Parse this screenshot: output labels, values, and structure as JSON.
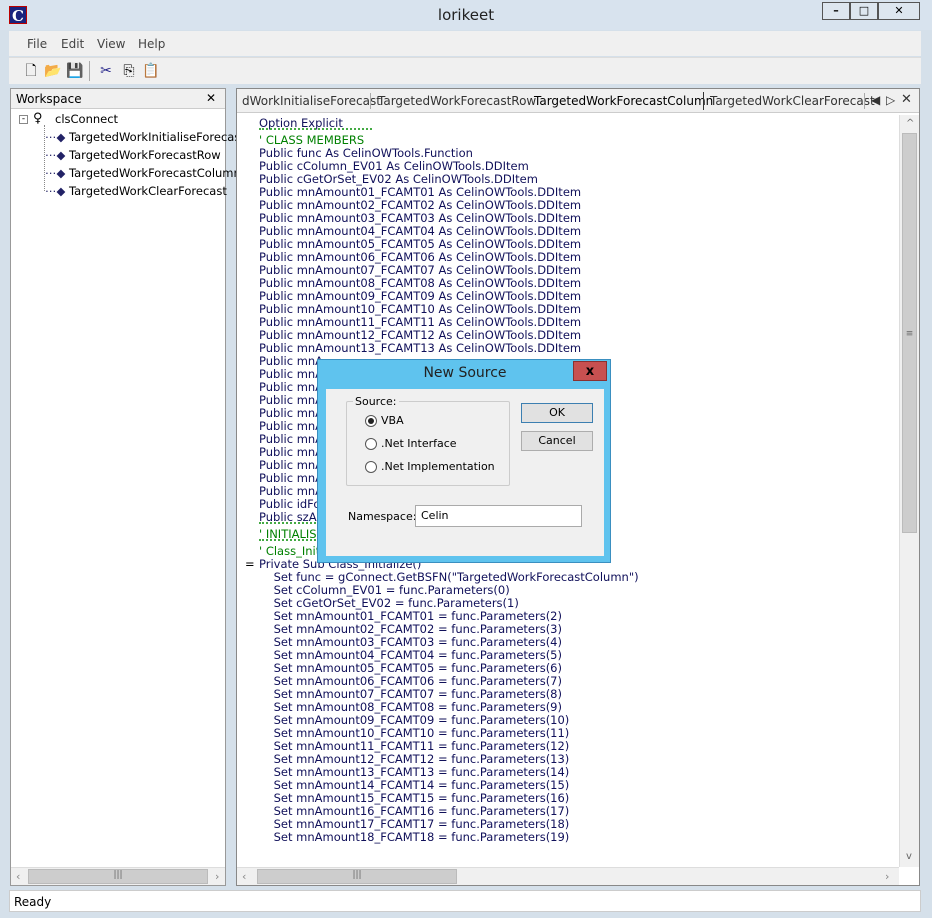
{
  "window": {
    "title": "lorikeet",
    "minimize": "–",
    "maximize": "□",
    "close": "✕"
  },
  "menu": [
    "File",
    "Edit",
    "View",
    "Help"
  ],
  "toolbar": [
    "new-icon",
    "open-icon",
    "save-icon",
    "cut-icon",
    "copy-icon",
    "paste-icon"
  ],
  "workspace": {
    "title": "Workspace",
    "close": "✕",
    "root": "clsConnect",
    "items": [
      "TargetedWorkInitialiseForecast",
      "TargetedWorkForecastRow",
      "TargetedWorkForecastColumn",
      "TargetedWorkClearForecast"
    ]
  },
  "editor": {
    "tabs": [
      "dWorkInitialiseForecast",
      "TargetedWorkForecastRow",
      "TargetedWorkForecastColumn",
      "TargetedWorkClearForecast"
    ],
    "active_tab": 2,
    "colors": {
      "keyword": "#10105a",
      "comment": "#008000"
    },
    "lines": [
      "Option Explicit",
      "",
      "' CLASS MEMBERS",
      "Public func As CelinOWTools.Function",
      "Public cColumn_EV01 As CelinOWTools.DDItem",
      "Public cGetOrSet_EV02 As CelinOWTools.DDItem",
      "Public mnAmount01_FCAMT01 As CelinOWTools.DDItem",
      "Public mnAmount02_FCAMT02 As CelinOWTools.DDItem",
      "Public mnAmount03_FCAMT03 As CelinOWTools.DDItem",
      "Public mnAmount04_FCAMT04 As CelinOWTools.DDItem",
      "Public mnAmount05_FCAMT05 As CelinOWTools.DDItem",
      "Public mnAmount06_FCAMT06 As CelinOWTools.DDItem",
      "Public mnAmount07_FCAMT07 As CelinOWTools.DDItem",
      "Public mnAmount08_FCAMT08 As CelinOWTools.DDItem",
      "Public mnAmount09_FCAMT09 As CelinOWTools.DDItem",
      "Public mnAmount10_FCAMT10 As CelinOWTools.DDItem",
      "Public mnAmount11_FCAMT11 As CelinOWTools.DDItem",
      "Public mnAmount12_FCAMT12 As CelinOWTools.DDItem",
      "Public mnAmount13_FCAMT13 As CelinOWTools.DDItem",
      "Public mnA",
      "Public mnA",
      "Public mnA",
      "Public mnA",
      "Public mnA",
      "Public mnA",
      "Public mnA",
      "Public mnA",
      "Public mnA",
      "Public mnA",
      "Public mnA",
      "Public idFo",
      "Public szA",
      "",
      "' INITIALIS",
      "",
      "' Class_Initialize",
      "Private Sub Class_Initialize()",
      "    Set func = gConnect.GetBSFN(\"TargetedWorkForecastColumn\")",
      "    Set cColumn_EV01 = func.Parameters(0)",
      "    Set cGetOrSet_EV02 = func.Parameters(1)",
      "    Set mnAmount01_FCAMT01 = func.Parameters(2)",
      "    Set mnAmount02_FCAMT02 = func.Parameters(3)",
      "    Set mnAmount03_FCAMT03 = func.Parameters(4)",
      "    Set mnAmount04_FCAMT04 = func.Parameters(5)",
      "    Set mnAmount05_FCAMT05 = func.Parameters(6)",
      "    Set mnAmount06_FCAMT06 = func.Parameters(7)",
      "    Set mnAmount07_FCAMT07 = func.Parameters(8)",
      "    Set mnAmount08_FCAMT08 = func.Parameters(9)",
      "    Set mnAmount09_FCAMT09 = func.Parameters(10)",
      "    Set mnAmount10_FCAMT10 = func.Parameters(11)",
      "    Set mnAmount11_FCAMT11 = func.Parameters(12)",
      "    Set mnAmount12_FCAMT12 = func.Parameters(13)",
      "    Set mnAmount13_FCAMT13 = func.Parameters(14)",
      "    Set mnAmount14_FCAMT14 = func.Parameters(15)",
      "    Set mnAmount15_FCAMT15 = func.Parameters(16)",
      "    Set mnAmount16_FCAMT16 = func.Parameters(17)",
      "    Set mnAmount17_FCAMT17 = func.Parameters(18)",
      "    Set mnAmount18_FCAMT18 = func.Parameters(19)"
    ]
  },
  "status": "Ready",
  "dialog": {
    "title": "New Source",
    "close": "x",
    "group_label": "Source:",
    "options": [
      "VBA",
      ".Net Interface",
      ".Net Implementation"
    ],
    "selected": 0,
    "ok": "OK",
    "cancel": "Cancel",
    "namespace_label": "Namespace:",
    "namespace_value": "Celin"
  }
}
